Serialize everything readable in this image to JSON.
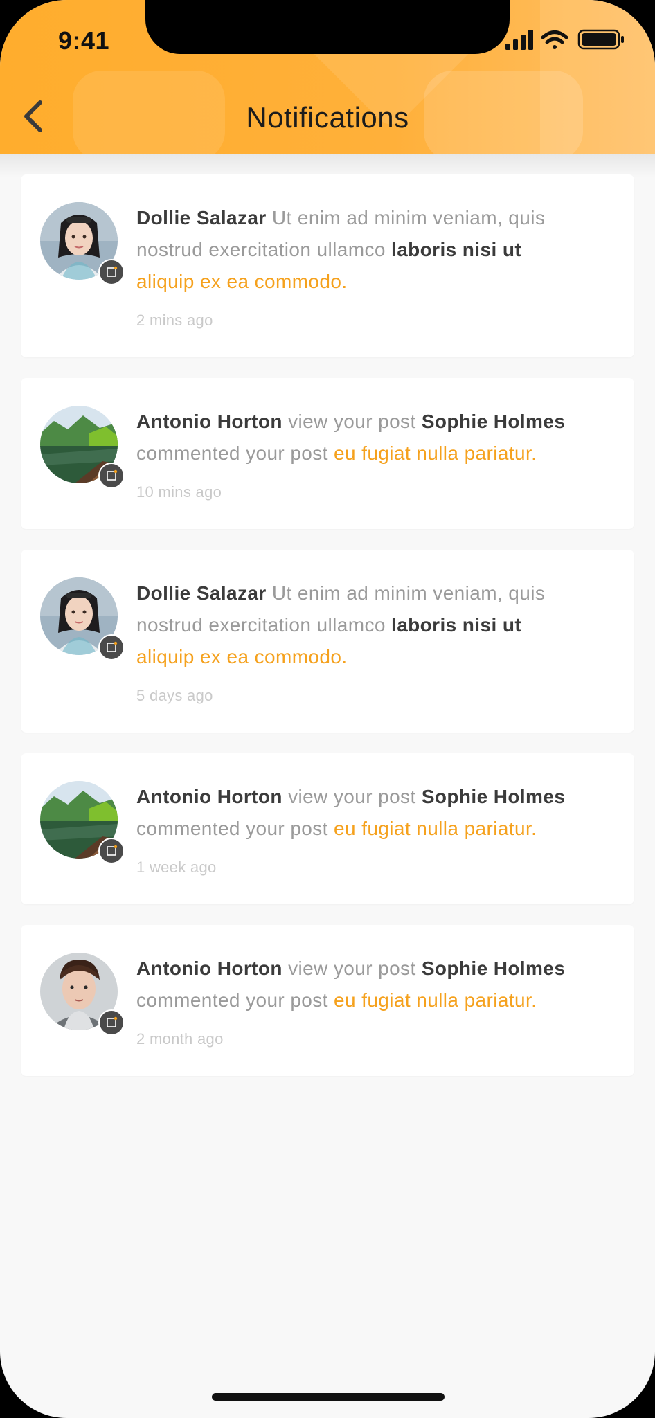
{
  "status_bar": {
    "time": "9:41"
  },
  "header": {
    "title": "Notifications",
    "back_icon": "chevron-left-icon"
  },
  "colors": {
    "header_accent": "#ffad2d",
    "highlight_text": "#f5a11d",
    "name_text": "#3b3b3b",
    "body_text": "#9a9a9a",
    "time_text": "#c9c9c9",
    "background": "#f8f8f8"
  },
  "notifications": [
    {
      "avatar": "woman-portrait-avatar",
      "name": "Dollie Salazar",
      "text1": "Ut enim ad minim veniam, quis",
      "text2": "nostrud exercitation ullamco",
      "bold2": "laboris nisi ut",
      "highlight": "aliquip ex ea commodo.",
      "time": "2 mins ago"
    },
    {
      "avatar": "lake-landscape-avatar",
      "name": "Antonio Horton",
      "text1": "view your post",
      "bold1": "Sophie Holmes",
      "text2": "commented your post",
      "highlight": "eu fugiat nulla pariatur.",
      "time": "10 mins ago"
    },
    {
      "avatar": "woman-portrait-avatar",
      "name": "Dollie Salazar",
      "text1": "Ut enim ad minim veniam, quis",
      "text2": "nostrud exercitation ullamco",
      "bold2": "laboris nisi ut",
      "highlight": "aliquip ex ea commodo.",
      "time": "5 days ago"
    },
    {
      "avatar": "lake-landscape-avatar",
      "name": "Antonio Horton",
      "text1": "view your post",
      "bold1": "Sophie Holmes",
      "text2": "commented your post",
      "highlight": "eu fugiat nulla pariatur.",
      "time": "1 week ago"
    },
    {
      "avatar": "man-portrait-avatar",
      "name": "Antonio Horton",
      "text1": "view your post",
      "bold1": "Sophie Holmes",
      "text2": "commented your post",
      "highlight": "eu fugiat nulla pariatur.",
      "time": "2 month ago"
    }
  ]
}
